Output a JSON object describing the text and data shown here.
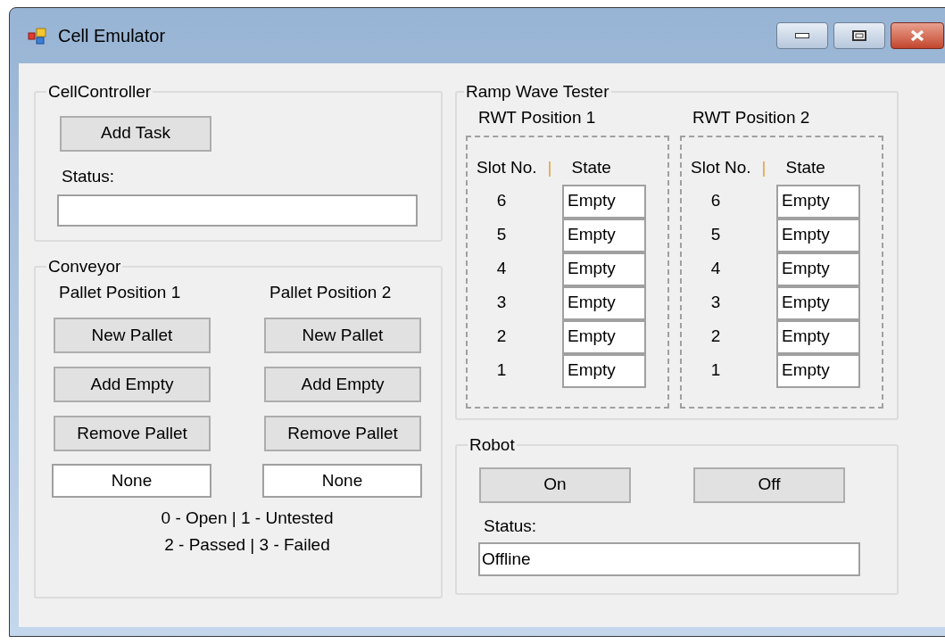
{
  "window": {
    "title": "Cell Emulator"
  },
  "cell_controller": {
    "title": "CellController",
    "button": "Add Task",
    "status_label": "Status:"
  },
  "conveyor": {
    "title": "Conveyor",
    "positions": [
      {
        "title": "Pallet Position 1",
        "buttons": [
          "New Pallet",
          "Add Empty",
          "Remove Pallet"
        ],
        "value": "None"
      },
      {
        "title": "Pallet Position 2",
        "buttons": [
          "New Pallet",
          "Add Empty",
          "Remove Pallet"
        ],
        "value": "None"
      }
    ],
    "legend": [
      "0 - Open | 1 - Untested",
      "2 - Passed | 3 - Failed"
    ]
  },
  "ramp_wave_tester": {
    "title": "Ramp Wave Tester",
    "positions": [
      {
        "title": "RWT Position 1",
        "slot_header": "Slot No.",
        "separator": "|",
        "state_header": "State",
        "slots": [
          {
            "number": "6",
            "state": "Empty"
          },
          {
            "number": "5",
            "state": "Empty"
          },
          {
            "number": "4",
            "state": "Empty"
          },
          {
            "number": "3",
            "state": "Empty"
          },
          {
            "number": "2",
            "state": "Empty"
          },
          {
            "number": "1",
            "state": "Empty"
          }
        ]
      },
      {
        "title": "RWT Position 2",
        "slot_header": "Slot No.",
        "separator": "|",
        "state_header": "State",
        "slots": [
          {
            "number": "6",
            "state": "Empty"
          },
          {
            "number": "5",
            "state": "Empty"
          },
          {
            "number": "4",
            "state": "Empty"
          },
          {
            "number": "3",
            "state": "Empty"
          },
          {
            "number": "2",
            "state": "Empty"
          },
          {
            "number": "1",
            "state": "Empty"
          }
        ]
      }
    ]
  },
  "robot": {
    "title": "Robot",
    "buttons": [
      "On",
      "Off"
    ],
    "status_label": "Status:",
    "status_value": "Offline"
  }
}
